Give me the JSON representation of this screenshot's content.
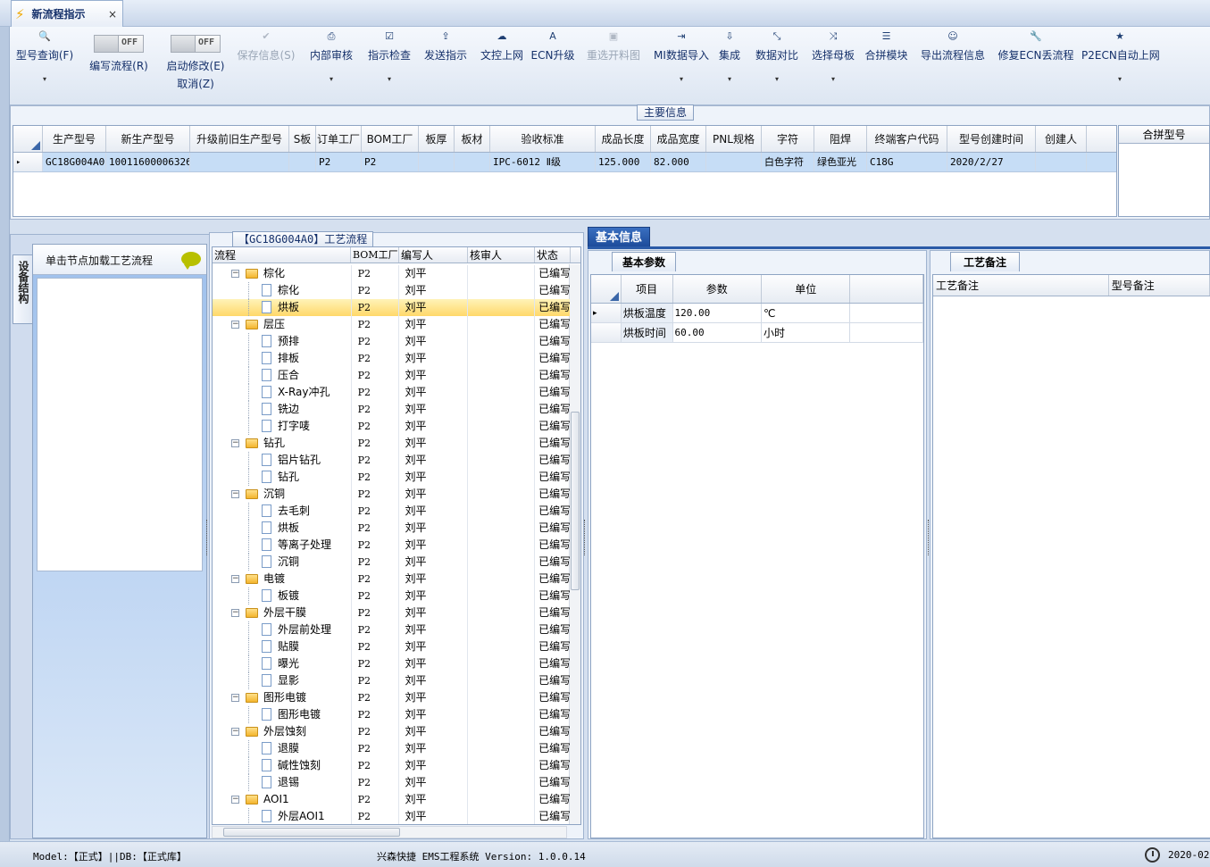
{
  "tab": {
    "title": "新流程指示",
    "close": "×"
  },
  "toolbar": {
    "items": [
      {
        "label": "型号查询(F)",
        "icon": "search-icon",
        "glyph": "🔍",
        "dd": "▾"
      },
      {
        "label": "编写流程(R)",
        "toggle": "OFF"
      },
      {
        "label": "启动修改(E)",
        "sub": "取消(Z)",
        "toggle": "OFF"
      },
      {
        "label": "保存信息(S)",
        "icon": "check-icon",
        "glyph": "✔",
        "disabled": true
      },
      {
        "label": "内部审核",
        "icon": "printer-icon",
        "glyph": "⎙",
        "dd": "▾"
      },
      {
        "label": "指示检查",
        "icon": "checkbox-icon",
        "glyph": "☑",
        "dd": "▾"
      },
      {
        "label": "发送指示",
        "icon": "upload-icon",
        "glyph": "⇪"
      },
      {
        "label": "文控上网",
        "icon": "cloud-upload-icon",
        "glyph": "☁"
      },
      {
        "label": "ECN升级",
        "icon": "font-icon",
        "glyph": "A"
      },
      {
        "label": "重选开料图",
        "icon": "image-icon",
        "glyph": "▣",
        "disabled": true
      },
      {
        "label": "MI数据导入",
        "icon": "sign-in-icon",
        "glyph": "⇥",
        "dd": "▾"
      },
      {
        "label": "集成",
        "icon": "download-icon",
        "glyph": "⇩",
        "dd": "▾"
      },
      {
        "label": "数据对比",
        "icon": "compress-icon",
        "glyph": "⤡",
        "dd": "▾"
      },
      {
        "label": "选择母板",
        "icon": "random-icon",
        "glyph": "⤨",
        "dd": "▾"
      },
      {
        "label": "合拼模块",
        "icon": "list-icon",
        "glyph": "☰"
      },
      {
        "label": "导出流程信息",
        "icon": "smile-icon",
        "glyph": "☺"
      },
      {
        "label": "修复ECN丢流程",
        "icon": "wrench-icon",
        "glyph": "🔧"
      },
      {
        "label": "P2ECN自动上网",
        "icon": "star-icon",
        "glyph": "★",
        "dd": "▾"
      }
    ]
  },
  "main_info": {
    "title": "主要信息",
    "columns": [
      "生产型号",
      "新生产型号",
      "升级前旧生产型号",
      "S板",
      "订单工厂",
      "BOM工厂",
      "板厚",
      "板材",
      "验收标准",
      "成品长度",
      "成品宽度",
      "PNL规格",
      "字符",
      "阻焊",
      "终端客户代码",
      "型号创建时间",
      "创建人"
    ],
    "row": [
      "GC18G004A0",
      "10011600006326",
      "",
      "",
      "P2",
      "P2",
      "",
      "",
      "IPC-6012 Ⅱ级",
      "125.000",
      "82.000",
      "",
      "白色字符",
      "绿色亚光",
      "C18G",
      "2020/2/27",
      ""
    ],
    "row_marker": "▸",
    "merge_header": "合拼型号"
  },
  "left_panel": {
    "vertical_tab": "设备结构",
    "hint": "单击节点加载工艺流程"
  },
  "flow": {
    "title": "【GC18G004A0】工艺流程",
    "columns": [
      "流程",
      "BOM工厂",
      "编写人",
      "核审人",
      "状态"
    ],
    "rows": [
      {
        "name": "棕化",
        "level": 0,
        "bom": "P2",
        "writer": "刘平",
        "status": "已编写"
      },
      {
        "name": "棕化",
        "level": 1,
        "bom": "P2",
        "writer": "刘平",
        "status": "已编写"
      },
      {
        "name": "烘板",
        "level": 1,
        "bom": "P2",
        "writer": "刘平",
        "status": "已编写",
        "selected": true
      },
      {
        "name": "层压",
        "level": 0,
        "bom": "P2",
        "writer": "刘平",
        "status": "已编写"
      },
      {
        "name": "预排",
        "level": 1,
        "bom": "P2",
        "writer": "刘平",
        "status": "已编写"
      },
      {
        "name": "排板",
        "level": 1,
        "bom": "P2",
        "writer": "刘平",
        "status": "已编写"
      },
      {
        "name": "压合",
        "level": 1,
        "bom": "P2",
        "writer": "刘平",
        "status": "已编写"
      },
      {
        "name": "X-Ray冲孔",
        "level": 1,
        "bom": "P2",
        "writer": "刘平",
        "status": "已编写"
      },
      {
        "name": "铣边",
        "level": 1,
        "bom": "P2",
        "writer": "刘平",
        "status": "已编写"
      },
      {
        "name": "打字唛",
        "level": 1,
        "bom": "P2",
        "writer": "刘平",
        "status": "已编写"
      },
      {
        "name": "钻孔",
        "level": 0,
        "bom": "P2",
        "writer": "刘平",
        "status": "已编写"
      },
      {
        "name": "铝片钻孔",
        "level": 1,
        "bom": "P2",
        "writer": "刘平",
        "status": "已编写"
      },
      {
        "name": "钻孔",
        "level": 1,
        "bom": "P2",
        "writer": "刘平",
        "status": "已编写"
      },
      {
        "name": "沉铜",
        "level": 0,
        "bom": "P2",
        "writer": "刘平",
        "status": "已编写"
      },
      {
        "name": "去毛刺",
        "level": 1,
        "bom": "P2",
        "writer": "刘平",
        "status": "已编写"
      },
      {
        "name": "烘板",
        "level": 1,
        "bom": "P2",
        "writer": "刘平",
        "status": "已编写"
      },
      {
        "name": "等离子处理",
        "level": 1,
        "bom": "P2",
        "writer": "刘平",
        "status": "已编写"
      },
      {
        "name": "沉铜",
        "level": 1,
        "bom": "P2",
        "writer": "刘平",
        "status": "已编写"
      },
      {
        "name": "电镀",
        "level": 0,
        "bom": "P2",
        "writer": "刘平",
        "status": "已编写"
      },
      {
        "name": "板镀",
        "level": 1,
        "bom": "P2",
        "writer": "刘平",
        "status": "已编写"
      },
      {
        "name": "外层干膜",
        "level": 0,
        "bom": "P2",
        "writer": "刘平",
        "status": "已编写"
      },
      {
        "name": "外层前处理",
        "level": 1,
        "bom": "P2",
        "writer": "刘平",
        "status": "已编写"
      },
      {
        "name": "贴膜",
        "level": 1,
        "bom": "P2",
        "writer": "刘平",
        "status": "已编写"
      },
      {
        "name": "曝光",
        "level": 1,
        "bom": "P2",
        "writer": "刘平",
        "status": "已编写"
      },
      {
        "name": "显影",
        "level": 1,
        "bom": "P2",
        "writer": "刘平",
        "status": "已编写"
      },
      {
        "name": "图形电镀",
        "level": 0,
        "bom": "P2",
        "writer": "刘平",
        "status": "已编写"
      },
      {
        "name": "图形电镀",
        "level": 1,
        "bom": "P2",
        "writer": "刘平",
        "status": "已编写"
      },
      {
        "name": "外层蚀刻",
        "level": 0,
        "bom": "P2",
        "writer": "刘平",
        "status": "已编写"
      },
      {
        "name": "退膜",
        "level": 1,
        "bom": "P2",
        "writer": "刘平",
        "status": "已编写"
      },
      {
        "name": "碱性蚀刻",
        "level": 1,
        "bom": "P2",
        "writer": "刘平",
        "status": "已编写"
      },
      {
        "name": "退锡",
        "level": 1,
        "bom": "P2",
        "writer": "刘平",
        "status": "已编写"
      },
      {
        "name": "AOI1",
        "level": 0,
        "bom": "P2",
        "writer": "刘平",
        "status": "已编写"
      },
      {
        "name": "外层AOI1",
        "level": 1,
        "bom": "P2",
        "writer": "刘平",
        "status": "已编写"
      }
    ]
  },
  "basic_info": {
    "tab": "基本信息",
    "params_tab": "基本参数",
    "columns": [
      "项目",
      "参数",
      "单位"
    ],
    "rows": [
      {
        "item": "烘板温度",
        "value": "120.00",
        "unit": "℃"
      },
      {
        "item": "烘板时间",
        "value": "60.00",
        "unit": "小时"
      }
    ],
    "row_marker": "▸"
  },
  "notes": {
    "tab": "工艺备注",
    "columns": [
      "工艺备注",
      "型号备注"
    ]
  },
  "status": {
    "model": "Model:【正式】||DB:【正式库】",
    "app": "兴森快捷 EMS工程系统 Version: 1.0.0.14",
    "time": "2020-02-"
  }
}
